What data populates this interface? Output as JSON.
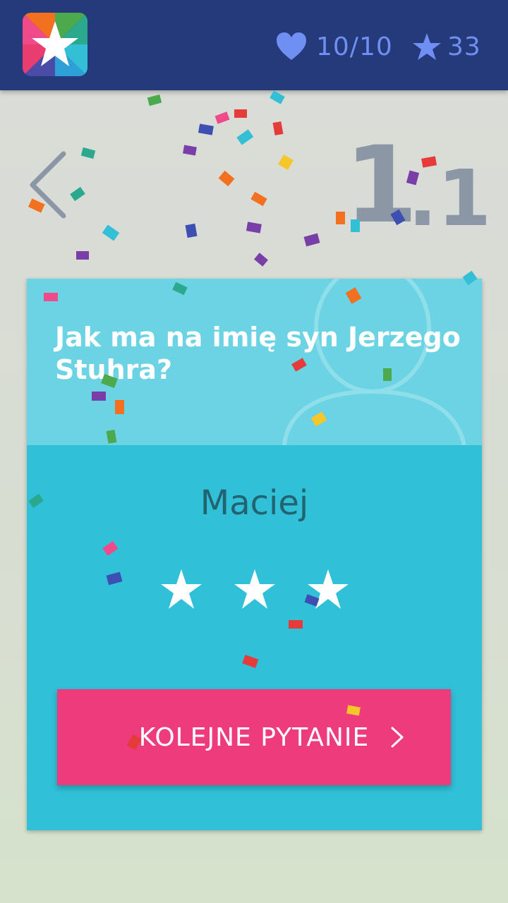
{
  "header": {
    "lives": "10/10",
    "stars": "33"
  },
  "level": {
    "major": "1",
    "minor": ".1"
  },
  "question": {
    "text": "Jak ma na imię syn Jerzego Stuhra?"
  },
  "answer": {
    "text": "Maciej",
    "rating": 3,
    "max_rating": 3
  },
  "buttons": {
    "next_label": "KOLEJNE PYTANIE"
  },
  "colors": {
    "header_bg": "#243a7a",
    "accent_blue": "#6f8ff2",
    "card_top": "#6bd3e3",
    "card_bottom": "#30c0d8",
    "button": "#ee3b7b"
  }
}
